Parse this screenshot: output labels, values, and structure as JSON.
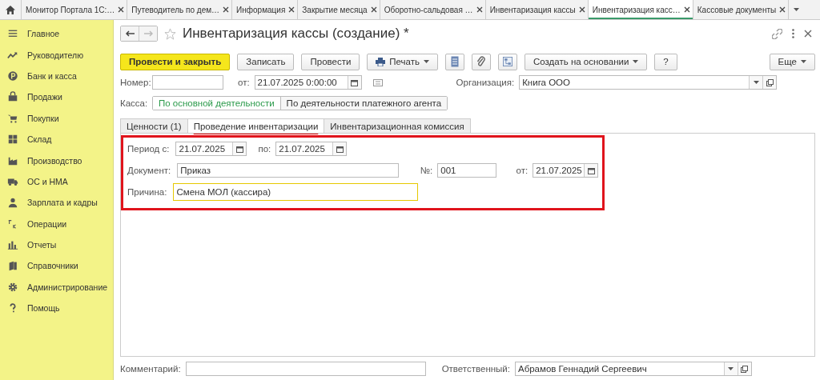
{
  "window_tabs": [
    {
      "label": "Монитор Портала 1С:…",
      "selected": false
    },
    {
      "label": "Путеводитель по дем…",
      "selected": false
    },
    {
      "label": "Информация",
      "selected": false
    },
    {
      "label": "Закрытие месяца",
      "selected": false
    },
    {
      "label": "Оборотно-сальдовая …",
      "selected": false
    },
    {
      "label": "Инвентаризация кассы",
      "selected": false
    },
    {
      "label": "Инвентаризация касс…",
      "selected": true
    },
    {
      "label": "Кассовые документы",
      "selected": false
    }
  ],
  "sidebar": {
    "items": [
      {
        "label": "Главное"
      },
      {
        "label": "Руководителю"
      },
      {
        "label": "Банк и касса"
      },
      {
        "label": "Продажи"
      },
      {
        "label": "Покупки"
      },
      {
        "label": "Склад"
      },
      {
        "label": "Производство"
      },
      {
        "label": "ОС и НМА"
      },
      {
        "label": "Зарплата и кадры"
      },
      {
        "label": "Операции"
      },
      {
        "label": "Отчеты"
      },
      {
        "label": "Справочники"
      },
      {
        "label": "Администрирование"
      },
      {
        "label": "Помощь"
      }
    ]
  },
  "form": {
    "title": "Инвентаризация кассы (создание) *",
    "toolbar": [
      {
        "kind": "primary",
        "label": "Провести и закрыть"
      },
      {
        "kind": "plain",
        "label": "Записать"
      },
      {
        "kind": "plain",
        "label": "Провести"
      },
      {
        "kind": "print",
        "label": "Печать"
      },
      {
        "kind": "icon"
      },
      {
        "kind": "icon"
      },
      {
        "kind": "icon"
      },
      {
        "kind": "dropdown",
        "label": "Создать на основании"
      },
      {
        "kind": "plain",
        "label": "?"
      },
      {
        "kind": "more",
        "label": "Еще"
      }
    ],
    "number": {
      "label": "Номер:"
    },
    "date": {
      "label": "от:",
      "value": "21.07.2025  0:00:00"
    },
    "organization": {
      "label": "Организация:",
      "value": "Книга ООО"
    },
    "cashbox": {
      "label": "Касса:",
      "options": [
        {
          "label": "По основной деятельности",
          "selected": true
        },
        {
          "label": "По деятельности платежного агента",
          "selected": false
        }
      ]
    },
    "tabs": [
      {
        "label": "Ценности (1)",
        "selected": false
      },
      {
        "label": "Проведение инвентаризации",
        "selected": true
      },
      {
        "label": "Инвентаризационная комиссия",
        "selected": false
      }
    ],
    "period_from": {
      "label": "Период с:",
      "value": "21.07.2025"
    },
    "period_to": {
      "label": "по:",
      "value": "21.07.2025"
    },
    "document": {
      "label": "Документ:",
      "value": "Приказ"
    },
    "doc_number": {
      "label": "№:",
      "value": "001"
    },
    "doc_date": {
      "label": "от:",
      "value": "21.07.2025"
    },
    "reason": {
      "label": "Причина:",
      "value": "Смена МОЛ (кассира)"
    },
    "comment": {
      "label": "Комментарий:"
    },
    "responsible": {
      "label": "Ответственный:",
      "value": "Абрамов Геннадий Сергеевич"
    }
  }
}
